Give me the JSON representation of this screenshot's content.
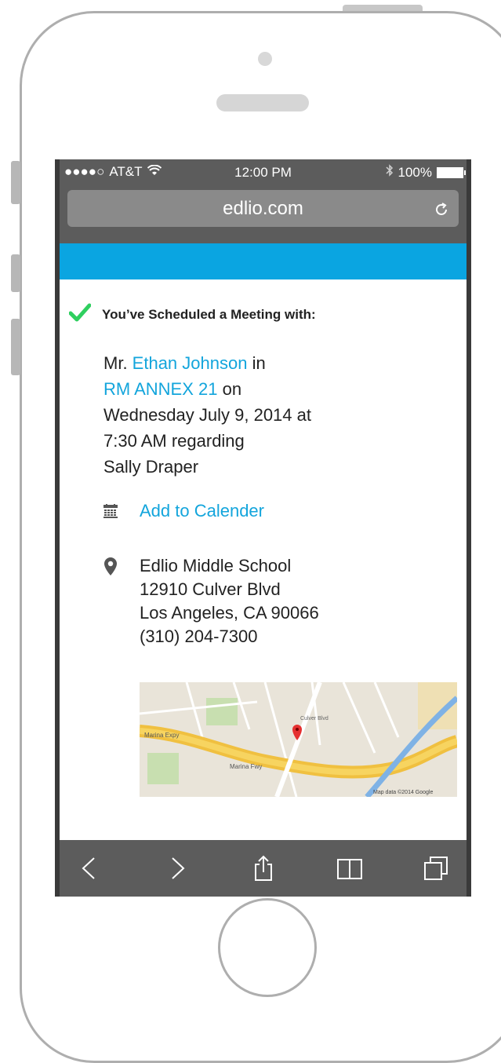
{
  "status_bar": {
    "signal": "●●●●○",
    "carrier": "AT&T",
    "wifi_icon": "wifi-icon",
    "time": "12:00 PM",
    "bluetooth_icon": "bluetooth-icon",
    "battery_text": "100%"
  },
  "browser": {
    "url": "edlio.com",
    "reload_icon": "reload-icon"
  },
  "confirmation": {
    "heading": "You’ve Scheduled a Meeting with:",
    "line1_prefix": "Mr. ",
    "teacher_name": "Ethan Johnson",
    "line1_suffix": " in",
    "room": "RM ANNEX 21",
    "room_suffix": " on",
    "date_line": "Wednesday July 9, 2014 at",
    "time_line": "7:30 AM regarding",
    "student": "Sally Draper"
  },
  "calendar": {
    "label": "Add to Calender"
  },
  "address": {
    "school": "Edlio Middle School",
    "street": "12910 Culver Blvd",
    "city": "Los Angeles, CA 90066",
    "phone": "(310) 204-7300"
  },
  "map": {
    "road_1": "Marina Expy",
    "road_2": "Marina Fwy",
    "road_3": "Culver Blvd",
    "attribution": "Map data ©2014 Google"
  },
  "colors": {
    "accent_blue": "#0aa5e1",
    "link_blue": "#13a5dc",
    "check_green": "#2fcf5f"
  }
}
